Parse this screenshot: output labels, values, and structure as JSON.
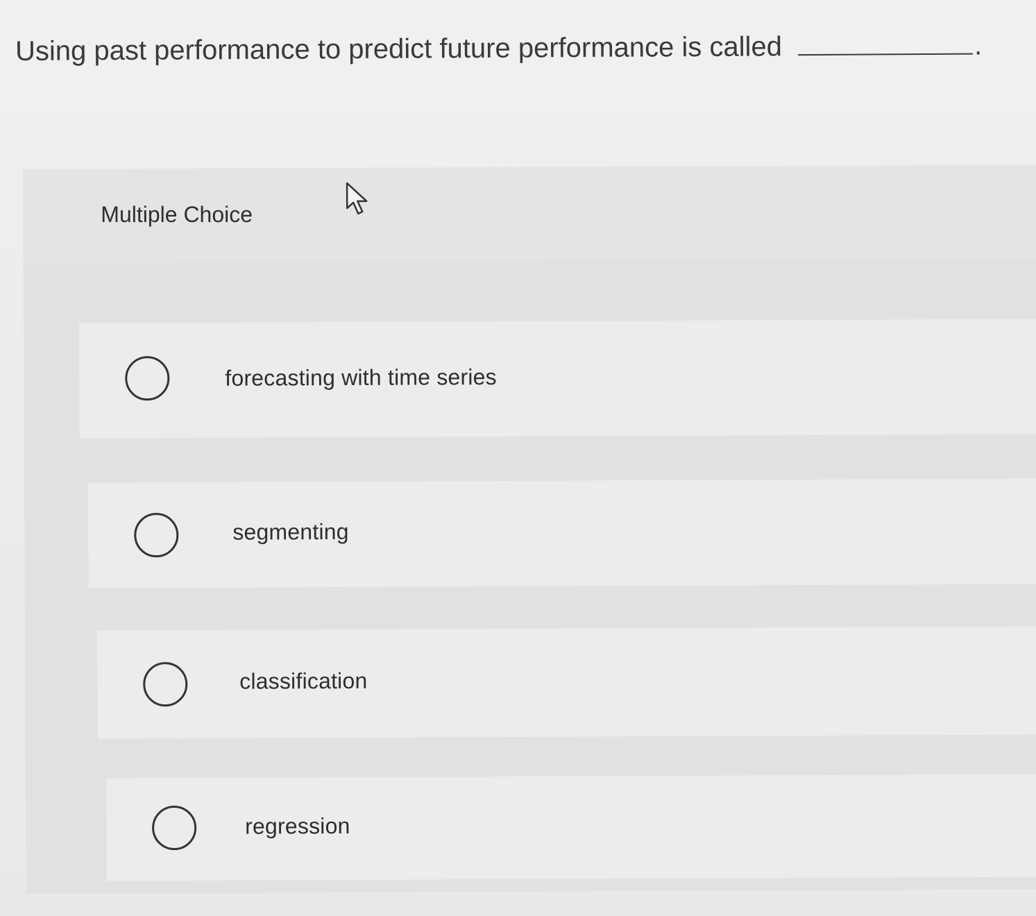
{
  "question": {
    "text": "Using past performance to predict future performance is called",
    "period": "."
  },
  "quiz": {
    "type_label": "Multiple Choice",
    "options": [
      {
        "label": "forecasting with time series",
        "selected": false
      },
      {
        "label": "segmenting",
        "selected": false
      },
      {
        "label": "classification",
        "selected": false
      },
      {
        "label": "regression",
        "selected": false
      }
    ]
  },
  "icons": {
    "cursor": "mouse-pointer-icon"
  }
}
